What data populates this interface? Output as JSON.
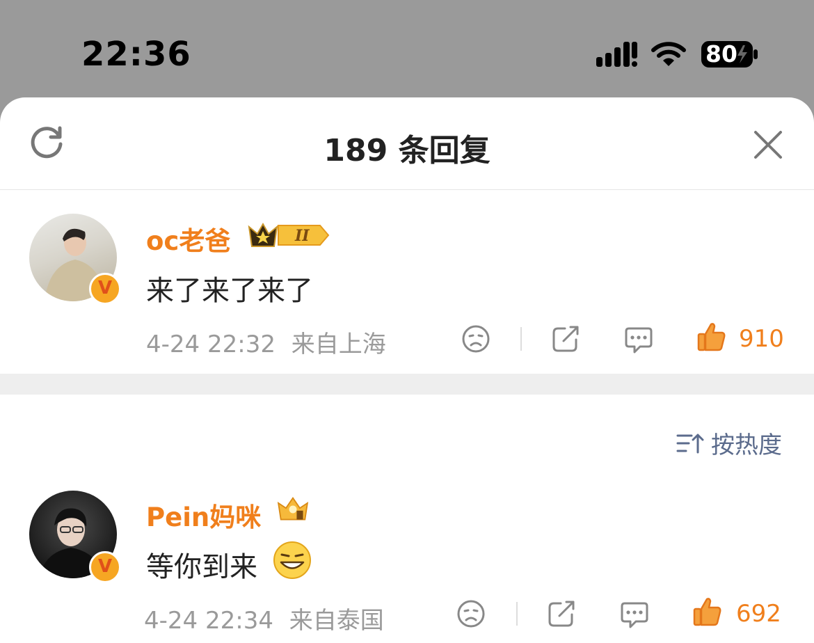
{
  "status_bar": {
    "time": "22:36",
    "battery": "80"
  },
  "sheet": {
    "title": "189 条回复"
  },
  "sort": {
    "label": "按热度"
  },
  "comments": [
    {
      "username": "oc老爸",
      "text": "来了来了来了",
      "time": "4-24 22:32",
      "location": "来自上海",
      "likes": "910",
      "level": "II"
    },
    {
      "username": "Pein妈咪",
      "text": "等你到来",
      "time": "4-24 22:34",
      "location": "来自泰国",
      "likes": "692"
    }
  ],
  "colors": {
    "accent": "#f07f1c",
    "muted": "#9a9a9a",
    "link": "#5b6b8c"
  },
  "icons": [
    "refresh-icon",
    "close-icon",
    "dislike-icon",
    "share-icon",
    "reply-icon",
    "like-icon",
    "sort-icon",
    "verified-badge",
    "crown-badge",
    "grin-emoji"
  ]
}
